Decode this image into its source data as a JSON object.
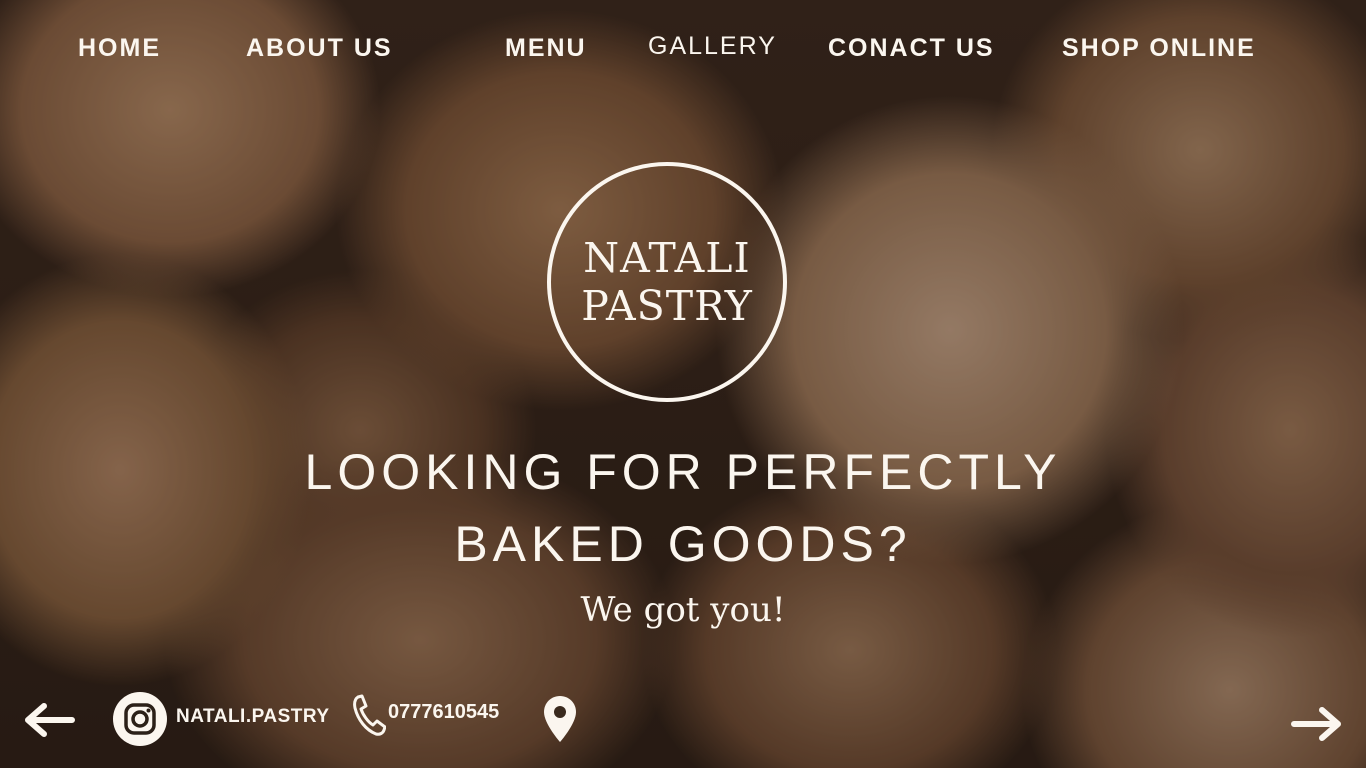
{
  "nav": {
    "home": "HOME",
    "about": "ABOUT US",
    "menu": "MENU",
    "gallery": "GALLERY",
    "contact": "CONACT US",
    "shop": "SHOP ONLINE"
  },
  "logo": {
    "line1": "NATALI",
    "line2": "PASTRY"
  },
  "hero": {
    "headline_line1": "LOOKING FOR PERFECTLY",
    "headline_line2": "BAKED GOODS?",
    "tagline": "We got you!"
  },
  "footer": {
    "instagram_handle": "NATALI.PASTRY",
    "phone": "0777610545",
    "icons": [
      "arrow-left-icon",
      "instagram-icon",
      "phone-icon",
      "location-pin-icon",
      "arrow-right-icon"
    ]
  },
  "colors": {
    "text": "#fbf6ef",
    "background_dark": "#3a2a1e",
    "bread_light": "#c5a488"
  }
}
